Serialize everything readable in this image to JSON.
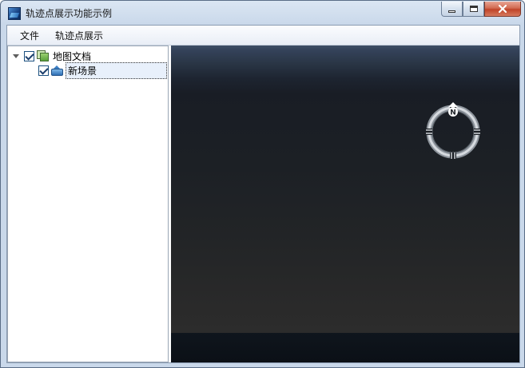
{
  "window": {
    "title": "轨迹点展示功能示例"
  },
  "menubar": {
    "items": [
      "文件",
      "轨迹点展示"
    ]
  },
  "tree": {
    "root": {
      "label": "地图文档",
      "checked": true,
      "expanded": true
    },
    "children": [
      {
        "label": "新场景",
        "checked": true,
        "selected": true
      }
    ]
  },
  "scene": {
    "compass_label": "N"
  },
  "colors": {
    "titlebar": "#c9d8ea",
    "close_button": "#c04428",
    "scene_sky": "#3e4f66",
    "scene_ground": "#2c2c2c"
  },
  "icons": {
    "app": "app-globe-icon",
    "minimize": "minimize-icon",
    "maximize": "maximize-icon",
    "close": "close-icon",
    "doc": "map-document-icon",
    "scene": "scene-icon",
    "compass": "compass-icon"
  }
}
